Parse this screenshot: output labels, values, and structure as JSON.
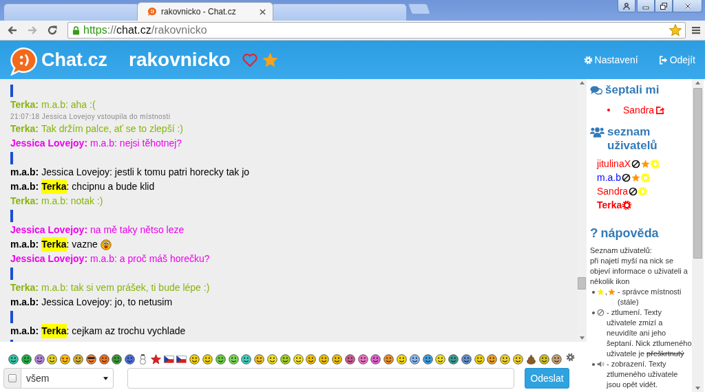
{
  "browser": {
    "tabs": [
      {
        "selected": false
      },
      {
        "title": "rakovnicko - Chat.cz",
        "selected": true
      },
      {
        "selected": false
      }
    ],
    "back_disabled": false,
    "forward_disabled": true,
    "url": {
      "scheme": "https",
      "separator": "://",
      "host": "chat.cz",
      "path": "/rakovnicko"
    },
    "bookmarked": true
  },
  "header": {
    "brand": "Chat.cz",
    "room": "rakovnicko",
    "liked": false,
    "starred": true,
    "menu": [
      {
        "kind": "settings",
        "label": "Nastavení"
      },
      {
        "kind": "logout",
        "label": "Odejít"
      }
    ]
  },
  "chat": {
    "messages": [
      {
        "kind": "divider"
      },
      {
        "kind": "message",
        "nick": "Terka:",
        "color": "#88b40c",
        "text": "m.a.b: aha :("
      },
      {
        "kind": "system",
        "text": "21:07:18 Jessica Lovejoy vstoupila do místnosti"
      },
      {
        "kind": "message",
        "nick": "Terka:",
        "color": "#88b40c",
        "text": "Tak držím palce, ať se to zlepší :)"
      },
      {
        "kind": "message",
        "nick": "Jessica Lovejoy:",
        "color": "#ee00ee",
        "text": "m.a.b: nejsi těhotnej?"
      },
      {
        "kind": "divider"
      },
      {
        "kind": "message",
        "nick": "m.a.b:",
        "color": "#000000",
        "text": "Jessica Lovejoy: jestli k tomu patri horecky tak jo"
      },
      {
        "kind": "message",
        "nick": "m.a.b:",
        "color": "#000000",
        "mention": "Terka",
        "text": ": chcipnu a bude klid"
      },
      {
        "kind": "message",
        "nick": "Terka:",
        "color": "#88b40c",
        "text": "m.a.b: notak :)"
      },
      {
        "kind": "divider"
      },
      {
        "kind": "message",
        "nick": "Jessica Lovejoy:",
        "color": "#ee00ee",
        "text": "na mě taky nětso leze"
      },
      {
        "kind": "message",
        "nick": "m.a.b:",
        "color": "#000000",
        "mention": "Terka",
        "text": ": vazne",
        "smiley": true
      },
      {
        "kind": "message",
        "nick": "Jessica Lovejoy:",
        "color": "#ee00ee",
        "text": "m.a.b: a proč máš horečku?"
      },
      {
        "kind": "divider"
      },
      {
        "kind": "message",
        "nick": "Terka:",
        "color": "#88b40c",
        "text": "m.a.b: tak si vem prášek, ti bude lépe :)"
      },
      {
        "kind": "message",
        "nick": "m.a.b:",
        "color": "#000000",
        "text": "Jessica Lovejoy: jo, to netusim"
      },
      {
        "kind": "divider"
      },
      {
        "kind": "message",
        "nick": "m.a.b:",
        "color": "#000000",
        "mention": "Terka",
        "text": ": cejkam az trochu vychlade"
      },
      {
        "kind": "divider"
      }
    ]
  },
  "sidebar": {
    "whispers": {
      "title": "šeptali mi",
      "items": [
        {
          "name": "Sandra",
          "color": "#ff0000"
        }
      ]
    },
    "users": {
      "title": "seznam uživatelů",
      "items": [
        {
          "name": "jitulinaX",
          "color": "#ff0000",
          "current": false,
          "badges": [
            {
              "kind": "muted"
            },
            {
              "kind": "admin",
              "color": "#ff9900"
            },
            {
              "kind": "status",
              "color": "#ffff00"
            }
          ]
        },
        {
          "name": "m.a.b",
          "color": "#0000ff",
          "current": false,
          "badges": [
            {
              "kind": "muted"
            },
            {
              "kind": "admin",
              "color": "#ff9900"
            },
            {
              "kind": "status",
              "color": "#ffff00"
            }
          ]
        },
        {
          "name": "Sandra",
          "color": "#ff0000",
          "current": false,
          "badges": [
            {
              "kind": "muted"
            },
            {
              "kind": "status",
              "color": "#ffff00"
            }
          ]
        },
        {
          "name": "Terka",
          "color": "#ff0000",
          "current": true,
          "badges": [
            {
              "kind": "status",
              "color": "#ff0000"
            }
          ]
        }
      ]
    },
    "help": {
      "icon": "?",
      "title": "nápověda",
      "intro": [
        "Seznam uživatelů:",
        "při najetí myší na nick se objeví informace o uživateli a několik ikon"
      ],
      "items": [
        {
          "parts": [
            {
              "kind": "star",
              "color": "#ffee00"
            },
            {
              "kind": "text",
              "text": ","
            },
            {
              "kind": "star",
              "color": "#ff9900"
            },
            {
              "kind": "text",
              "text": "- správce místnosti (stále)"
            }
          ]
        },
        {
          "parts": [
            {
              "kind": "muted"
            },
            {
              "kind": "text",
              "text": "- ztlumení. Texty uživatele zmizí a neuvidíte ani jeho šeptaní. Nick ztlumeného uživatele je",
              "struck": "přeškrtnutý"
            }
          ]
        },
        {
          "parts": [
            {
              "kind": "sound"
            },
            {
              "kind": "text",
              "text": "- zobrazení. Texty ztlumeného uživatele jsou opět vidět."
            }
          ]
        }
      ]
    }
  },
  "composer": {
    "private": {
      "checked": false
    },
    "recipient": "všem",
    "send_button": "Odeslat"
  }
}
